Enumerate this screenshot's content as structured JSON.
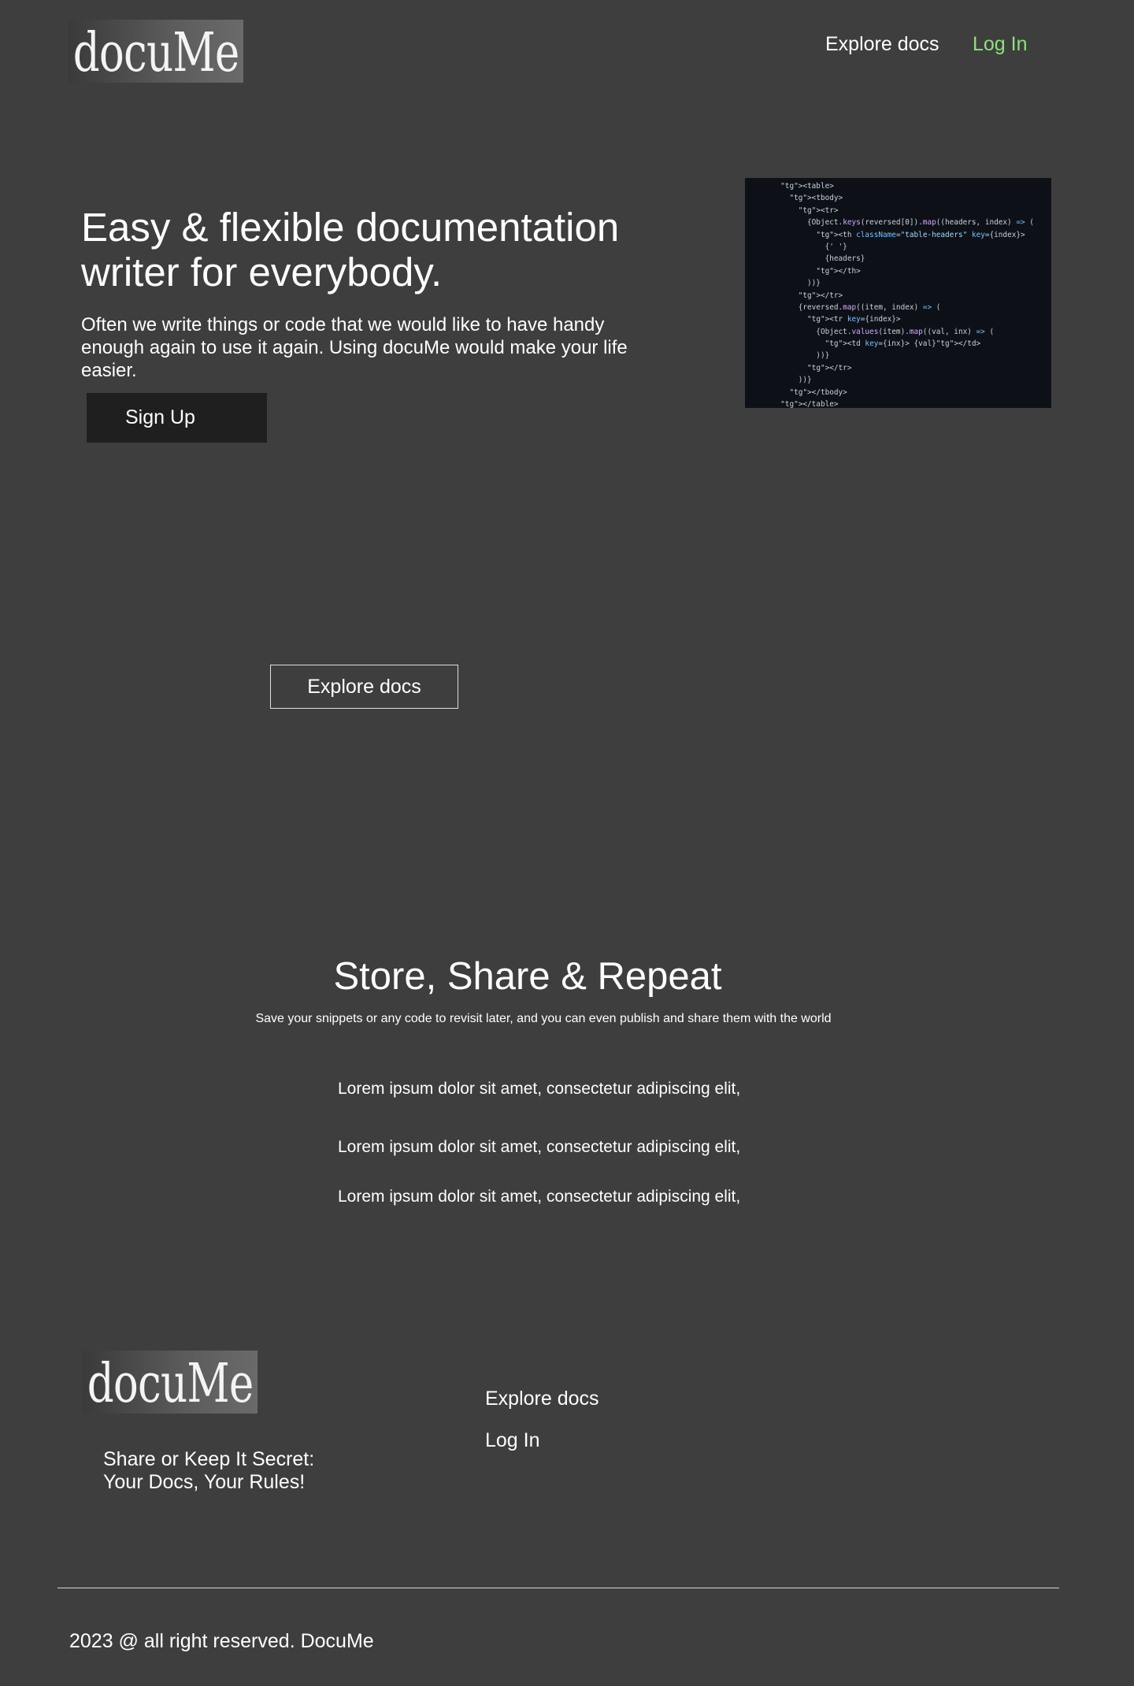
{
  "header": {
    "logo_text": "docuMe",
    "nav": {
      "explore": "Explore docs",
      "login": "Log In"
    }
  },
  "hero": {
    "title": "Easy & flexible documentation writer for everybody.",
    "description": "Often we write things or code that we would like to  have handy enough again to use it again. Using docuMe would make your life easier.",
    "signup_label": "Sign Up",
    "code_lines": [
      "        <table>",
      "          <tbody>",
      "            <tr>",
      "              {Object.keys(reversed[0]).map((headers, index) => (",
      "                <th className=\"table-headers\" key={index}>",
      "                  {' '}",
      "                  {headers}",
      "                </th>",
      "              ))}",
      "            </tr>",
      "            {reversed.map((item, index) => (",
      "              <tr key={index}>",
      "                {Object.values(item).map((val, inx) => (",
      "                  <td key={inx}> {val}</td>",
      "                ))}",
      "              </tr>",
      "            ))}",
      "          </tbody>",
      "        </table>"
    ]
  },
  "explore_button_label": "Explore docs",
  "features": {
    "title": "Store, Share & Repeat",
    "subtitle": "Save your snippets or any code to revisit later, and you can even publish and share them with the world",
    "items": [
      "Lorem ipsum dolor sit amet, consectetur adipiscing elit,",
      "Lorem ipsum dolor sit amet, consectetur adipiscing elit,",
      "Lorem ipsum dolor sit amet, consectetur adipiscing elit,"
    ]
  },
  "footer": {
    "logo_text": "docuMe",
    "tagline_1": "Share or Keep It Secret:",
    "tagline_2": "Your Docs, Your Rules!",
    "links": {
      "explore": "Explore docs",
      "login": "Log In"
    },
    "copyright": "2023 @ all right reserved. DocuMe"
  },
  "colors": {
    "background": "#3e3e3e",
    "login_accent": "#8ee07e",
    "button_dark": "#1f1f1f",
    "code_bg": "#0d1117"
  }
}
